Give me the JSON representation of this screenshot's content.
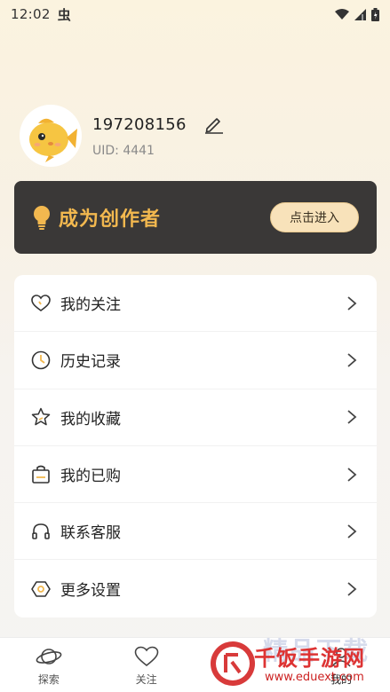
{
  "status_bar": {
    "time": "12:02",
    "app_badge": "虫"
  },
  "profile": {
    "username": "197208156",
    "uid": "UID: 4441"
  },
  "creator_banner": {
    "title": "成为创作者",
    "button_label": "点击进入"
  },
  "menu": {
    "items": [
      {
        "label": "我的关注",
        "icon": "heart-icon"
      },
      {
        "label": "历史记录",
        "icon": "clock-icon"
      },
      {
        "label": "我的收藏",
        "icon": "star-icon"
      },
      {
        "label": "我的已购",
        "icon": "shopping-bag-icon"
      },
      {
        "label": "联系客服",
        "icon": "headset-icon"
      },
      {
        "label": "更多设置",
        "icon": "settings-hexagon-icon"
      }
    ]
  },
  "bottom_nav": {
    "items": [
      {
        "label": "探索",
        "icon": "planet-icon"
      },
      {
        "label": "关注",
        "icon": "heart-icon"
      },
      {
        "label": "",
        "icon": "create-icon"
      },
      {
        "label": "我的",
        "icon": "profile-icon"
      }
    ]
  },
  "watermark": {
    "main": "千饭手游网",
    "sub": "www.eduext.com",
    "bg": "精品下载"
  },
  "colors": {
    "accent": "#f2b84f",
    "banner_bg": "#3a3837",
    "button_bg": "#f8e2ba",
    "watermark_red": "#d33333"
  }
}
